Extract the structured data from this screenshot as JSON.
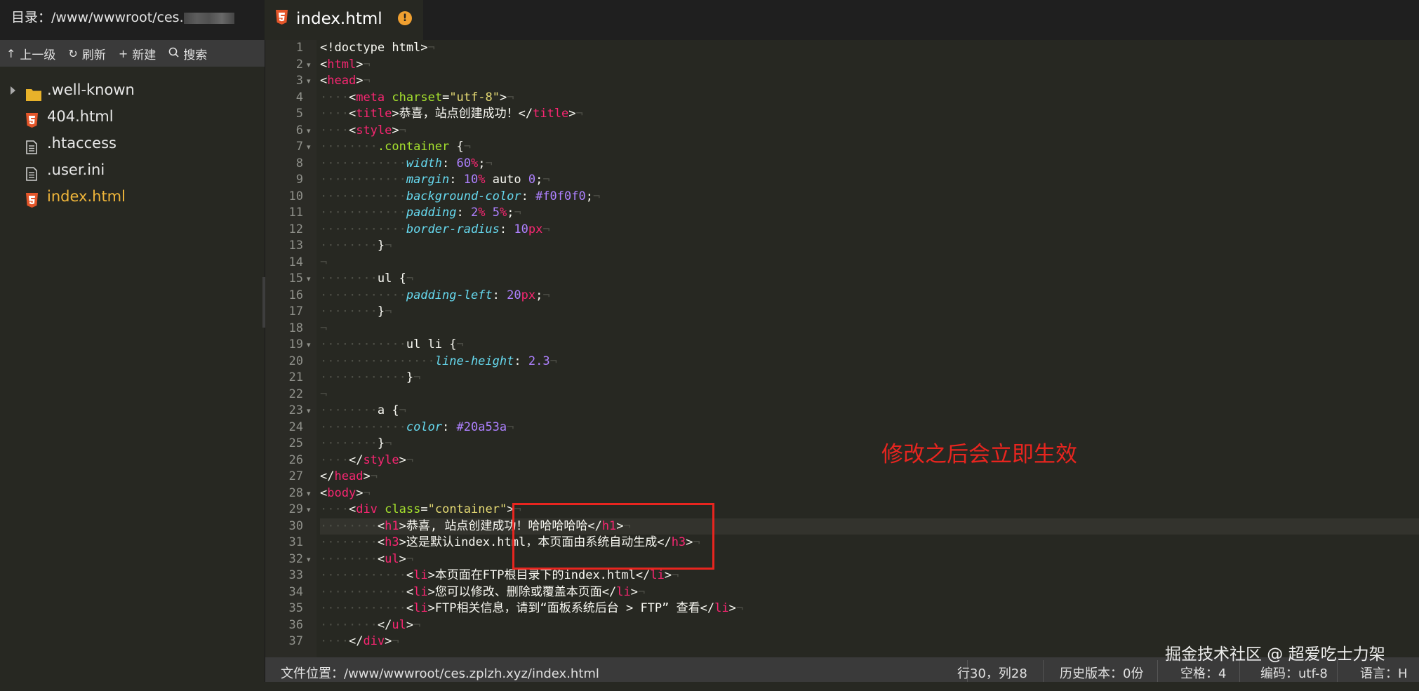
{
  "topbar": {
    "dir_label": "目录：",
    "dir_path": "/www/wwwroot/ces.",
    "active_tab": "index.html",
    "warning_mark": "!"
  },
  "toolbar": {
    "up_label": "上一级",
    "refresh_label": "刷新",
    "new_label": "新建",
    "search_label": "搜索"
  },
  "files": [
    {
      "name": ".well-known",
      "icon": "folder-icon"
    },
    {
      "name": "404.html",
      "icon": "html5-icon"
    },
    {
      "name": ".htaccess",
      "icon": "file-icon"
    },
    {
      "name": ".user.ini",
      "icon": "file-icon"
    },
    {
      "name": "index.html",
      "icon": "html5-icon",
      "active": true
    }
  ],
  "editor": {
    "line_numbers": [
      "1",
      "2",
      "3",
      "4",
      "5",
      "6",
      "7",
      "8",
      "9",
      "10",
      "11",
      "12",
      "13",
      "14",
      "15",
      "16",
      "17",
      "18",
      "19",
      "20",
      "21",
      "22",
      "23",
      "24",
      "25",
      "26",
      "27",
      "28",
      "29",
      "30",
      "31",
      "32",
      "33",
      "34",
      "35",
      "36",
      "37"
    ],
    "current_line": 30,
    "lines": [
      [
        [
          "t",
          "<!doctype html>"
        ],
        [
          "w",
          "¬"
        ]
      ],
      [
        [
          "t",
          "<"
        ],
        [
          "g",
          "html"
        ],
        [
          "t",
          ">"
        ],
        [
          "w",
          "¬"
        ]
      ],
      [
        [
          "t",
          "<"
        ],
        [
          "g",
          "head"
        ],
        [
          "t",
          ">"
        ],
        [
          "w",
          "¬"
        ]
      ],
      [
        [
          "w",
          "····"
        ],
        [
          "t",
          "<"
        ],
        [
          "g",
          "meta"
        ],
        [
          "t",
          " "
        ],
        [
          "a",
          "charset"
        ],
        [
          "t",
          "="
        ],
        [
          "s",
          "\"utf-8\""
        ],
        [
          "t",
          ">"
        ],
        [
          "w",
          "¬"
        ]
      ],
      [
        [
          "w",
          "····"
        ],
        [
          "t",
          "<"
        ],
        [
          "g",
          "title"
        ],
        [
          "t",
          ">恭喜，站点创建成功！</"
        ],
        [
          "g",
          "title"
        ],
        [
          "t",
          ">"
        ],
        [
          "w",
          "¬"
        ]
      ],
      [
        [
          "w",
          "····"
        ],
        [
          "t",
          "<"
        ],
        [
          "g",
          "style"
        ],
        [
          "t",
          ">"
        ],
        [
          "w",
          "¬"
        ]
      ],
      [
        [
          "w",
          "········"
        ],
        [
          "c",
          ".container"
        ],
        [
          "t",
          " {"
        ],
        [
          "w",
          "¬"
        ]
      ],
      [
        [
          "w",
          "············"
        ],
        [
          "p",
          "width"
        ],
        [
          "t",
          ": "
        ],
        [
          "n",
          "60"
        ],
        [
          "u",
          "%"
        ],
        [
          "t",
          ";"
        ],
        [
          "w",
          "¬"
        ]
      ],
      [
        [
          "w",
          "············"
        ],
        [
          "p",
          "margin"
        ],
        [
          "t",
          ": "
        ],
        [
          "n",
          "10"
        ],
        [
          "u",
          "%"
        ],
        [
          "t",
          " auto "
        ],
        [
          "n",
          "0"
        ],
        [
          "t",
          ";"
        ],
        [
          "w",
          "¬"
        ]
      ],
      [
        [
          "w",
          "············"
        ],
        [
          "p",
          "background-color"
        ],
        [
          "t",
          ": "
        ],
        [
          "n",
          "#f0f0f0"
        ],
        [
          "t",
          ";"
        ],
        [
          "w",
          "¬"
        ]
      ],
      [
        [
          "w",
          "············"
        ],
        [
          "p",
          "padding"
        ],
        [
          "t",
          ": "
        ],
        [
          "n",
          "2"
        ],
        [
          "u",
          "%"
        ],
        [
          "t",
          " "
        ],
        [
          "n",
          "5"
        ],
        [
          "u",
          "%"
        ],
        [
          "t",
          ";"
        ],
        [
          "w",
          "¬"
        ]
      ],
      [
        [
          "w",
          "············"
        ],
        [
          "p",
          "border-radius"
        ],
        [
          "t",
          ": "
        ],
        [
          "n",
          "10"
        ],
        [
          "u",
          "px"
        ],
        [
          "w",
          "¬"
        ]
      ],
      [
        [
          "w",
          "········"
        ],
        [
          "t",
          "}"
        ],
        [
          "w",
          "¬"
        ]
      ],
      [
        [
          "w",
          "¬"
        ]
      ],
      [
        [
          "w",
          "········"
        ],
        [
          "t",
          "ul {"
        ],
        [
          "w",
          "¬"
        ]
      ],
      [
        [
          "w",
          "············"
        ],
        [
          "p",
          "padding-left"
        ],
        [
          "t",
          ": "
        ],
        [
          "n",
          "20"
        ],
        [
          "u",
          "px"
        ],
        [
          "t",
          ";"
        ],
        [
          "w",
          "¬"
        ]
      ],
      [
        [
          "w",
          "········"
        ],
        [
          "t",
          "}"
        ],
        [
          "w",
          "¬"
        ]
      ],
      [
        [
          "w",
          "¬"
        ]
      ],
      [
        [
          "w",
          "············"
        ],
        [
          "t",
          "ul li {"
        ],
        [
          "w",
          "¬"
        ]
      ],
      [
        [
          "w",
          "················"
        ],
        [
          "p",
          "line-height"
        ],
        [
          "t",
          ": "
        ],
        [
          "n",
          "2.3"
        ],
        [
          "w",
          "¬"
        ]
      ],
      [
        [
          "w",
          "············"
        ],
        [
          "t",
          "}"
        ],
        [
          "w",
          "¬"
        ]
      ],
      [
        [
          "w",
          "¬"
        ]
      ],
      [
        [
          "w",
          "········"
        ],
        [
          "t",
          "a {"
        ],
        [
          "w",
          "¬"
        ]
      ],
      [
        [
          "w",
          "············"
        ],
        [
          "p",
          "color"
        ],
        [
          "t",
          ": "
        ],
        [
          "n",
          "#20a53a"
        ],
        [
          "w",
          "¬"
        ]
      ],
      [
        [
          "w",
          "········"
        ],
        [
          "t",
          "}"
        ],
        [
          "w",
          "¬"
        ]
      ],
      [
        [
          "w",
          "····"
        ],
        [
          "t",
          "</"
        ],
        [
          "g",
          "style"
        ],
        [
          "t",
          ">"
        ],
        [
          "w",
          "¬"
        ]
      ],
      [
        [
          "t",
          "</"
        ],
        [
          "g",
          "head"
        ],
        [
          "t",
          ">"
        ],
        [
          "w",
          "¬"
        ]
      ],
      [
        [
          "t",
          "<"
        ],
        [
          "g",
          "body"
        ],
        [
          "t",
          ">"
        ],
        [
          "w",
          "¬"
        ]
      ],
      [
        [
          "w",
          "····"
        ],
        [
          "t",
          "<"
        ],
        [
          "g",
          "div"
        ],
        [
          "t",
          " "
        ],
        [
          "a",
          "class"
        ],
        [
          "t",
          "="
        ],
        [
          "s",
          "\"container\""
        ],
        [
          "t",
          ">"
        ],
        [
          "w",
          "¬"
        ]
      ],
      [
        [
          "w",
          "········"
        ],
        [
          "t",
          "<"
        ],
        [
          "g",
          "h1"
        ],
        [
          "t",
          ">恭喜, 站点创建成功！哈哈哈哈哈</"
        ],
        [
          "g",
          "h1"
        ],
        [
          "t",
          ">"
        ],
        [
          "w",
          "¬"
        ]
      ],
      [
        [
          "w",
          "········"
        ],
        [
          "t",
          "<"
        ],
        [
          "g",
          "h3"
        ],
        [
          "t",
          ">这是默认index.html，本页面由系统自动生成</"
        ],
        [
          "g",
          "h3"
        ],
        [
          "t",
          ">"
        ],
        [
          "w",
          "¬"
        ]
      ],
      [
        [
          "w",
          "········"
        ],
        [
          "t",
          "<"
        ],
        [
          "g",
          "ul"
        ],
        [
          "t",
          ">"
        ],
        [
          "w",
          "¬"
        ]
      ],
      [
        [
          "w",
          "············"
        ],
        [
          "t",
          "<"
        ],
        [
          "g",
          "li"
        ],
        [
          "t",
          ">本页面在FTP根目录下的index.html</"
        ],
        [
          "g",
          "li"
        ],
        [
          "t",
          ">"
        ],
        [
          "w",
          "¬"
        ]
      ],
      [
        [
          "w",
          "············"
        ],
        [
          "t",
          "<"
        ],
        [
          "g",
          "li"
        ],
        [
          "t",
          ">您可以修改、删除或覆盖本页面</"
        ],
        [
          "g",
          "li"
        ],
        [
          "t",
          ">"
        ],
        [
          "w",
          "¬"
        ]
      ],
      [
        [
          "w",
          "············"
        ],
        [
          "t",
          "<"
        ],
        [
          "g",
          "li"
        ],
        [
          "t",
          ">FTP相关信息，请到“面板系统后台 > FTP” 查看</"
        ],
        [
          "g",
          "li"
        ],
        [
          "t",
          ">"
        ],
        [
          "w",
          "¬"
        ]
      ],
      [
        [
          "w",
          "········"
        ],
        [
          "t",
          "</"
        ],
        [
          "g",
          "ul"
        ],
        [
          "t",
          ">"
        ],
        [
          "w",
          "¬"
        ]
      ],
      [
        [
          "w",
          "····"
        ],
        [
          "t",
          "</"
        ],
        [
          "g",
          "div"
        ],
        [
          "t",
          ">"
        ],
        [
          "w",
          "¬"
        ]
      ]
    ]
  },
  "annotation": {
    "text": "修改之后会立即生效"
  },
  "statusbar": {
    "file_location": "文件位置：/www/wwwroot/ces.zplzh.xyz/index.html",
    "cursor": "行30，列28",
    "history": "历史版本：0份",
    "indent": "空格：4",
    "encoding": "编码：utf-8",
    "language": "语言：H"
  },
  "watermark": "掘金技术社区 @ 超爱吃士力架",
  "colors": {
    "keyword_tag": "#f92672",
    "attribute": "#a6e22e",
    "string": "#e6db74",
    "property": "#66d9ef",
    "number": "#ae81ff",
    "annotation_red": "#e8251f",
    "active_file": "#f0b63a"
  }
}
